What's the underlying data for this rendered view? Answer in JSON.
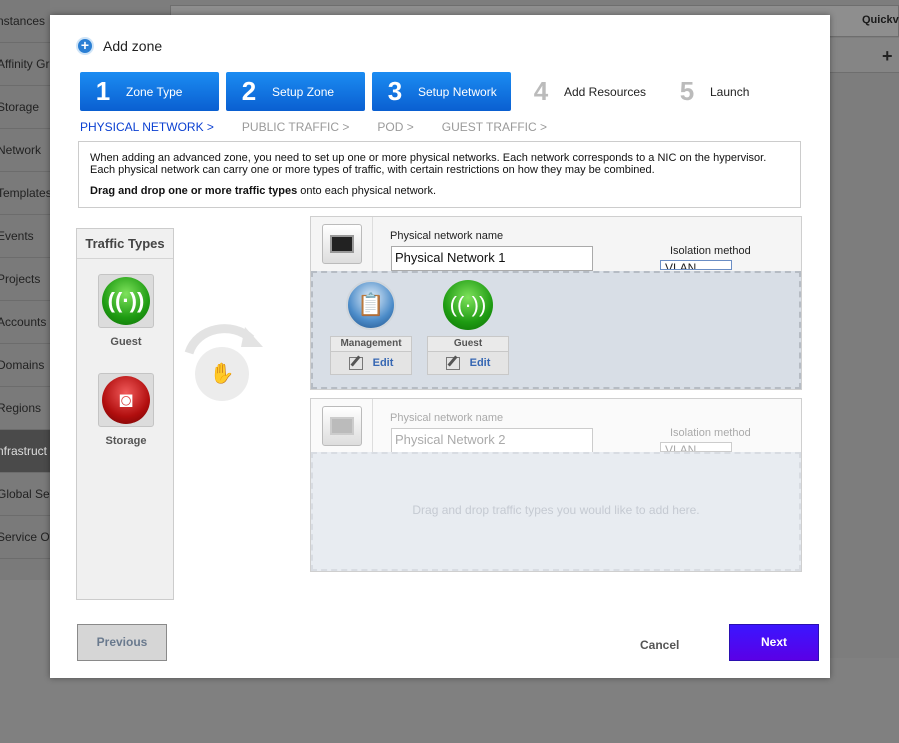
{
  "background": {
    "sidebar_items": [
      "nstances",
      "Affinity Gr",
      "Storage",
      "Network",
      "Templates",
      "Events",
      "Projects",
      "Accounts",
      "Domains",
      "Regions",
      "nfrastruct",
      "Global Set",
      "Service Of"
    ],
    "active_index": 10,
    "quickview_label": "Quickv",
    "row_action": "+"
  },
  "dialog": {
    "title": "Add zone",
    "steps": [
      {
        "num": "1",
        "label": "Zone Type"
      },
      {
        "num": "2",
        "label": "Setup Zone"
      },
      {
        "num": "3",
        "label": "Setup Network"
      },
      {
        "num": "4",
        "label": "Add Resources"
      },
      {
        "num": "5",
        "label": "Launch"
      }
    ],
    "subnav": [
      "PHYSICAL NETWORK >",
      "PUBLIC TRAFFIC >",
      "POD >",
      "GUEST TRAFFIC >"
    ],
    "info_text": "When adding an advanced zone, you need to set up one or more physical networks. Each network corresponds to a NIC on the hypervisor. Each physical network can carry one or more types of traffic, with certain restrictions on how they may be combined.",
    "info_bold": "Drag and drop one or more traffic types",
    "info_tail": " onto each physical network.",
    "traffic_types": {
      "title": "Traffic Types",
      "items": [
        {
          "label": "Guest"
        },
        {
          "label": "Storage"
        }
      ]
    },
    "physical_networks": [
      {
        "name_label": "Physical network name",
        "name_value": "Physical Network 1",
        "isolation_label": "Isolation method",
        "isolation_value": "VLAN",
        "traffic": [
          {
            "name": "Management",
            "edit": "Edit"
          },
          {
            "name": "Guest",
            "edit": "Edit"
          }
        ]
      },
      {
        "name_label": "Physical network name",
        "name_value": "Physical Network 2",
        "isolation_label": "Isolation method",
        "isolation_value": "VLAN",
        "drop_hint": "Drag and drop traffic types you would like to add here."
      }
    ],
    "buttons": {
      "previous": "Previous",
      "cancel": "Cancel",
      "next": "Next"
    }
  }
}
